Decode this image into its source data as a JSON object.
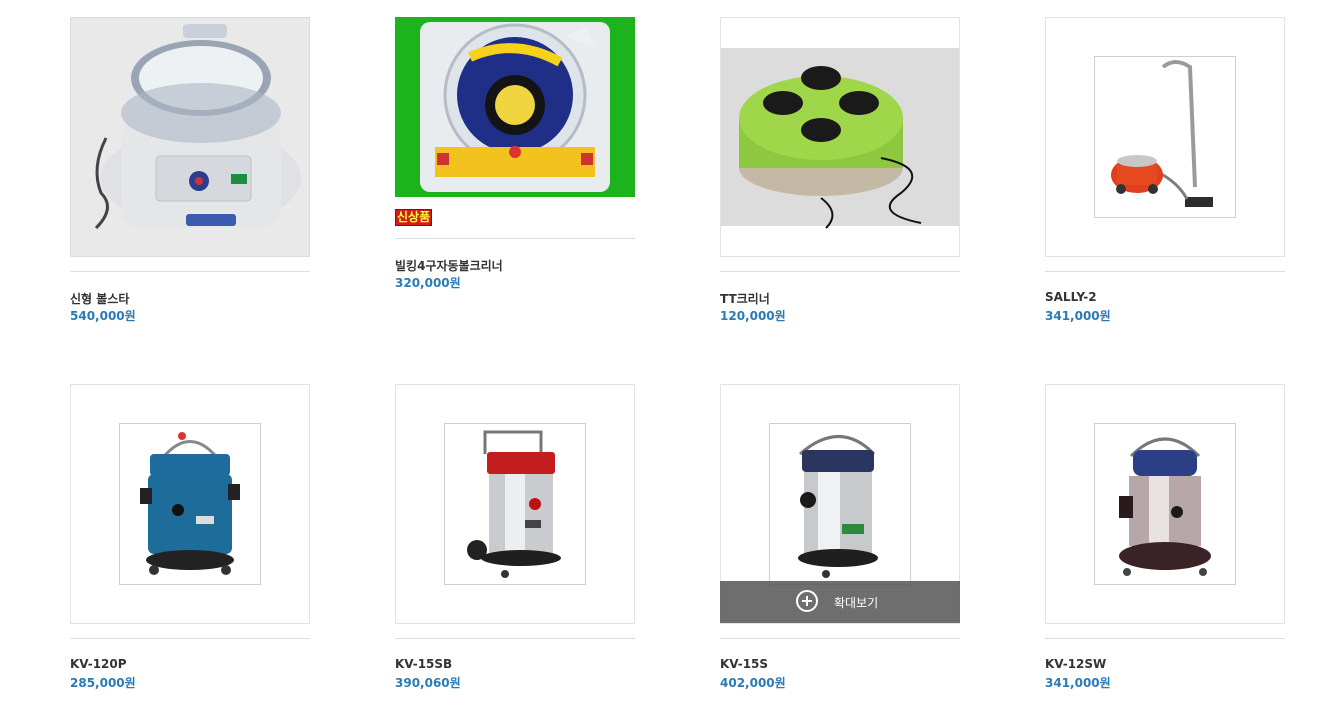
{
  "products": [
    {
      "name": "신형 볼스타",
      "price": "540,000원"
    },
    {
      "name": "빌킹4구자동볼크리너",
      "price": "320,000원",
      "badge": "신상품"
    },
    {
      "name": "TT크리너",
      "price": "120,000원"
    },
    {
      "name": "SALLY-2",
      "price": "341,000원"
    },
    {
      "name": "KV-120P",
      "price": "285,000원"
    },
    {
      "name": "KV-15SB",
      "price": "390,060원"
    },
    {
      "name": "KV-15S",
      "price": "402,000원"
    },
    {
      "name": "KV-12SW",
      "price": "341,000원"
    }
  ],
  "zoom": {
    "label": "확대보기",
    "icon": "plus-circle-icon"
  },
  "colors": {
    "price": "#2a7ab7",
    "name": "#333333",
    "border": "#e3e3e3",
    "overlay": "#5a5a5a"
  }
}
